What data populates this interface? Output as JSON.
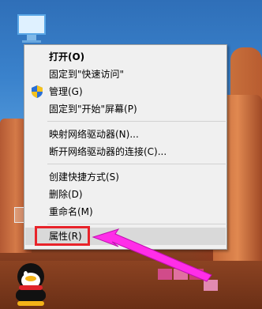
{
  "colors": {
    "highlight_box": "#e8232a",
    "annotation_arrow": "#ff2ee8",
    "menu_background": "#f0f0f0",
    "menu_hover": "#d9d9d9"
  },
  "desktop": {
    "icons": [
      {
        "name": "this-pc-icon"
      },
      {
        "name": "desktop-shortcut-icon"
      },
      {
        "name": "qq-penguin-icon"
      }
    ]
  },
  "context_menu": {
    "items": [
      {
        "label": "打开(O)",
        "bold": true
      },
      {
        "label": "固定到\"快速访问\""
      },
      {
        "label": "管理(G)",
        "icon": "uac-shield-icon"
      },
      {
        "label": "固定到\"开始\"屏幕(P)"
      },
      {
        "label": "映射网络驱动器(N)..."
      },
      {
        "label": "断开网络驱动器的连接(C)..."
      },
      {
        "label": "创建快捷方式(S)"
      },
      {
        "label": "删除(D)"
      },
      {
        "label": "重命名(M)"
      },
      {
        "label": "属性(R)",
        "highlighted": true
      }
    ]
  }
}
